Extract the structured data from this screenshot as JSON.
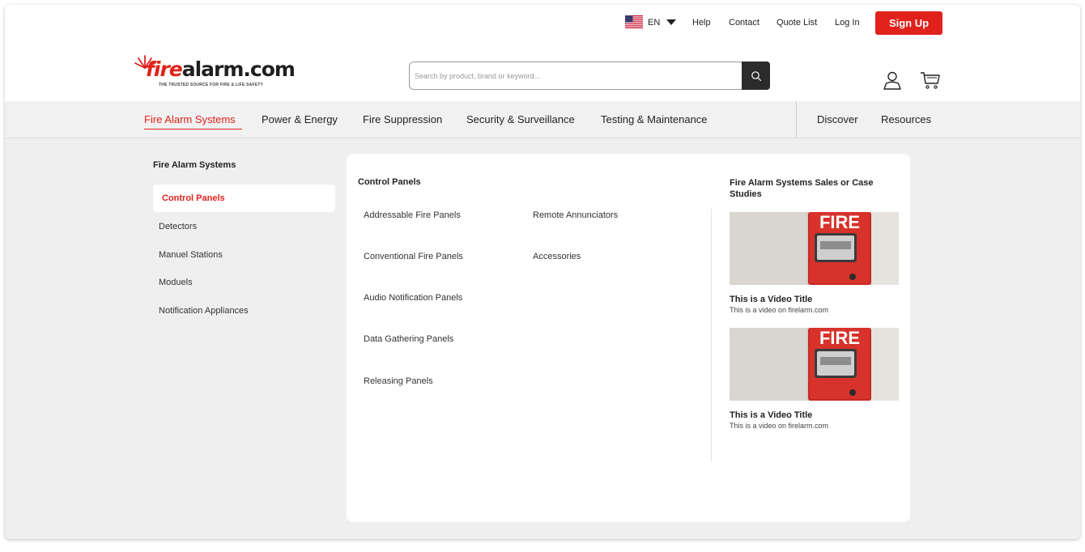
{
  "topbar": {
    "language": "EN",
    "links": [
      "Help",
      "Contact",
      "Quote List",
      "Log In"
    ],
    "signup_label": "Sign Up"
  },
  "header": {
    "logo": {
      "brand_fire": "fire",
      "brand_rest": "alarm.com",
      "tagline": "THE TRUSTED SOURCE FOR FIRE & LIFE SAFETY"
    },
    "search_placeholder": "Search by product, brand or keyword..."
  },
  "nav": {
    "items": [
      "Fire Alarm Systems",
      "Power & Energy",
      "Fire Suppression",
      "Security & Surveillance",
      "Testing & Maintenance"
    ],
    "right_items": [
      "Discover",
      "Resources"
    ],
    "active_index": 0
  },
  "sidebar": {
    "title": "Fire Alarm Systems",
    "items": [
      "Control Panels",
      "Detectors",
      "Manuel Stations",
      "Moduels",
      "Notification Appliances"
    ],
    "active_index": 0
  },
  "panel": {
    "title": "Control Panels",
    "column1": [
      "Addressable Fire Panels",
      "Conventional Fire Panels",
      "Audio Notification Panels",
      "Data Gathering Panels",
      "Releasing Panels"
    ],
    "column2": [
      "Remote Annunciators",
      "Accessories"
    ],
    "feature_title": "Fire Alarm Systems Sales or Case Studies",
    "videos": [
      {
        "title": "This is a Video Title",
        "subtitle": "This is a video on firelarm.com",
        "image_text": "FIRE"
      },
      {
        "title": "This is a Video Title",
        "subtitle": "This is a video on firelarm.com",
        "image_text": "FIRE"
      }
    ]
  },
  "colors": {
    "accent": "#e1221c",
    "nav_bg": "#f1f1f1",
    "page_bg": "#efefef"
  },
  "icons": [
    "us-flag-icon",
    "chevron-down-icon",
    "search-icon",
    "user-icon",
    "cart-icon"
  ]
}
